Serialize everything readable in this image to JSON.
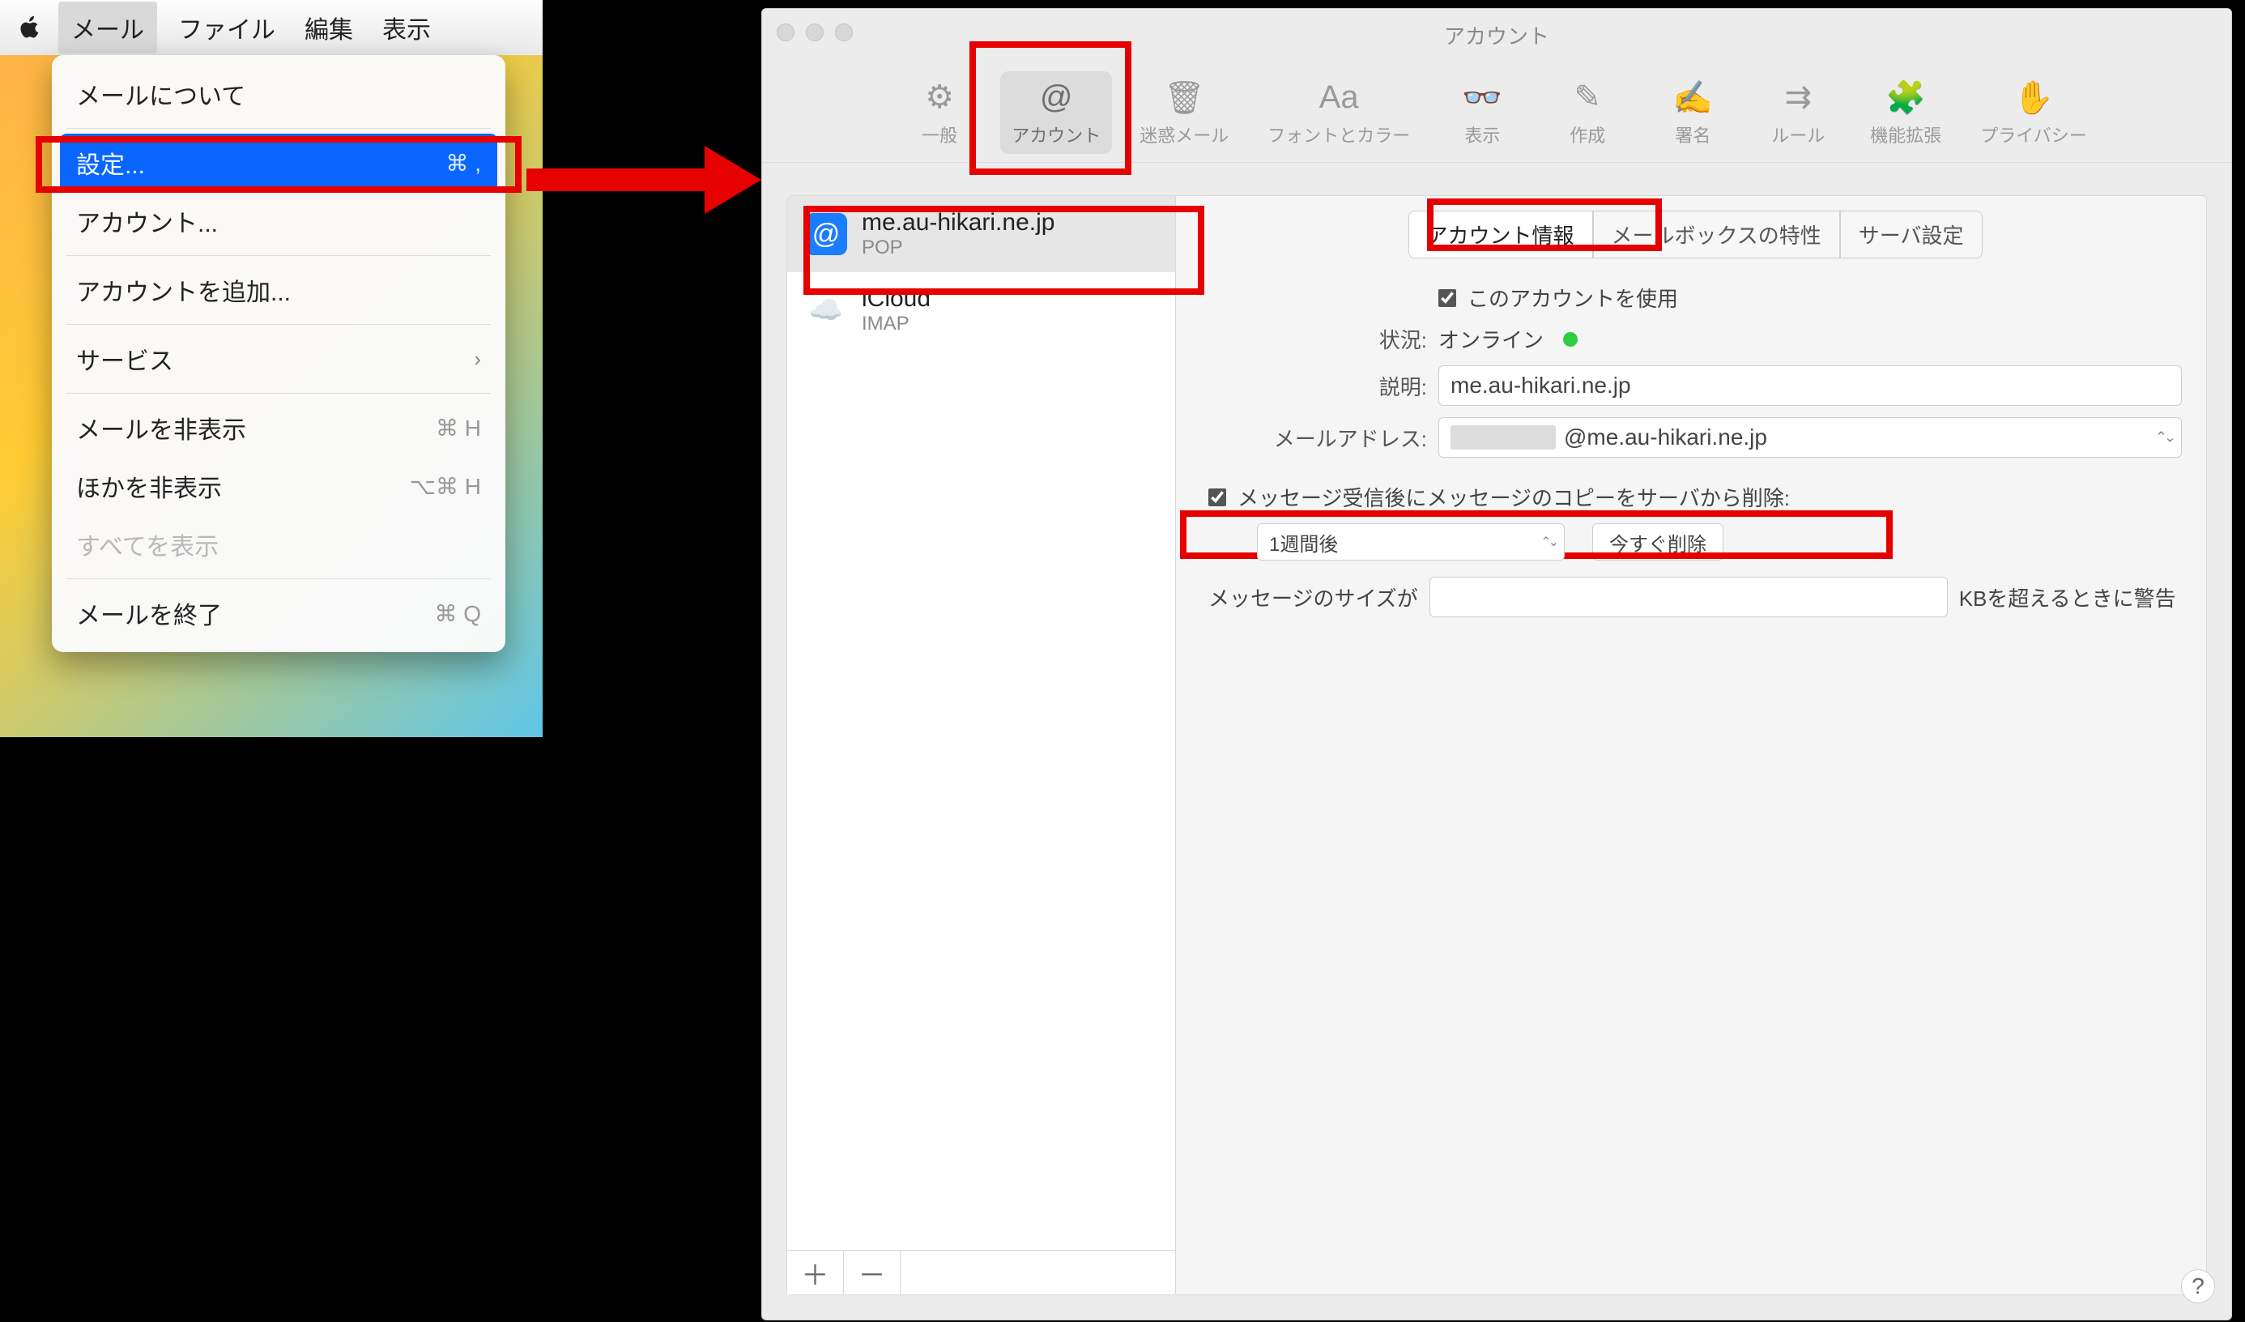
{
  "menubar": {
    "items": [
      "メール",
      "ファイル",
      "編集",
      "表示"
    ]
  },
  "dropdown": {
    "about": "メールについて",
    "settings": "設定...",
    "settings_shortcut": "⌘ ,",
    "accounts": "アカウント...",
    "add_account": "アカウントを追加...",
    "services": "サービス",
    "hide_mail": "メールを非表示",
    "hide_mail_shortcut": "⌘ H",
    "hide_others": "ほかを非表示",
    "hide_others_shortcut": "⌥⌘ H",
    "show_all": "すべてを表示",
    "quit": "メールを終了",
    "quit_shortcut": "⌘ Q"
  },
  "prefwin": {
    "title": "アカウント",
    "toolbar": {
      "general": "一般",
      "accounts": "アカウント",
      "junk": "迷惑メール",
      "fonts": "フォントとカラー",
      "viewing": "表示",
      "composing": "作成",
      "signatures": "署名",
      "rules": "ルール",
      "extensions": "機能拡張",
      "privacy": "プライバシー"
    },
    "accounts_list": [
      {
        "name": "me.au-hikari.ne.jp",
        "proto": "POP"
      },
      {
        "name": "iCloud",
        "proto": "IMAP"
      }
    ],
    "seg": {
      "info": "アカウント情報",
      "mailbox": "メールボックスの特性",
      "server": "サーバ設定"
    },
    "form": {
      "enable_label": "このアカウントを使用",
      "status_label": "状況:",
      "status_value": "オンライン",
      "desc_label": "説明:",
      "desc_value": "me.au-hikari.ne.jp",
      "email_label": "メールアドレス:",
      "email_value": "@me.au-hikari.ne.jp",
      "delete_copy_label": "メッセージ受信後にメッセージのコピーをサーバから削除:",
      "delete_after_value": "1週間後",
      "delete_now_btn": "今すぐ削除",
      "size_label_pre": "メッセージのサイズが",
      "size_label_post": "KBを超えるときに警告"
    },
    "add_btn": "＋",
    "remove_btn": "－",
    "help": "?"
  }
}
